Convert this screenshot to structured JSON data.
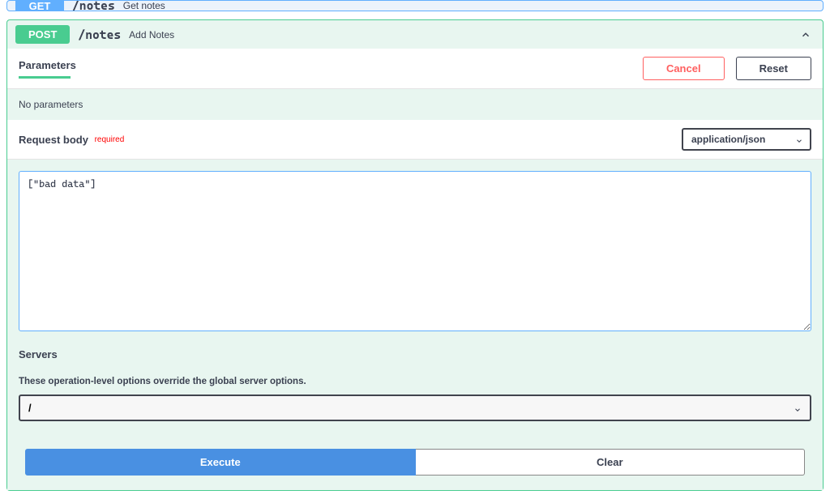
{
  "get_endpoint": {
    "method": "GET",
    "path": "/notes",
    "summary": "Get notes"
  },
  "post_endpoint": {
    "method": "POST",
    "path": "/notes",
    "summary": "Add Notes"
  },
  "parameters": {
    "title": "Parameters",
    "cancel_label": "Cancel",
    "reset_label": "Reset",
    "no_params_text": "No parameters"
  },
  "request_body": {
    "title": "Request body",
    "required_label": "required",
    "content_type": "application/json",
    "body_value": "[\"bad data\"]"
  },
  "servers": {
    "title": "Servers",
    "description": "These operation-level options override the global server options.",
    "selected": "/"
  },
  "actions": {
    "execute_label": "Execute",
    "clear_label": "Clear"
  }
}
